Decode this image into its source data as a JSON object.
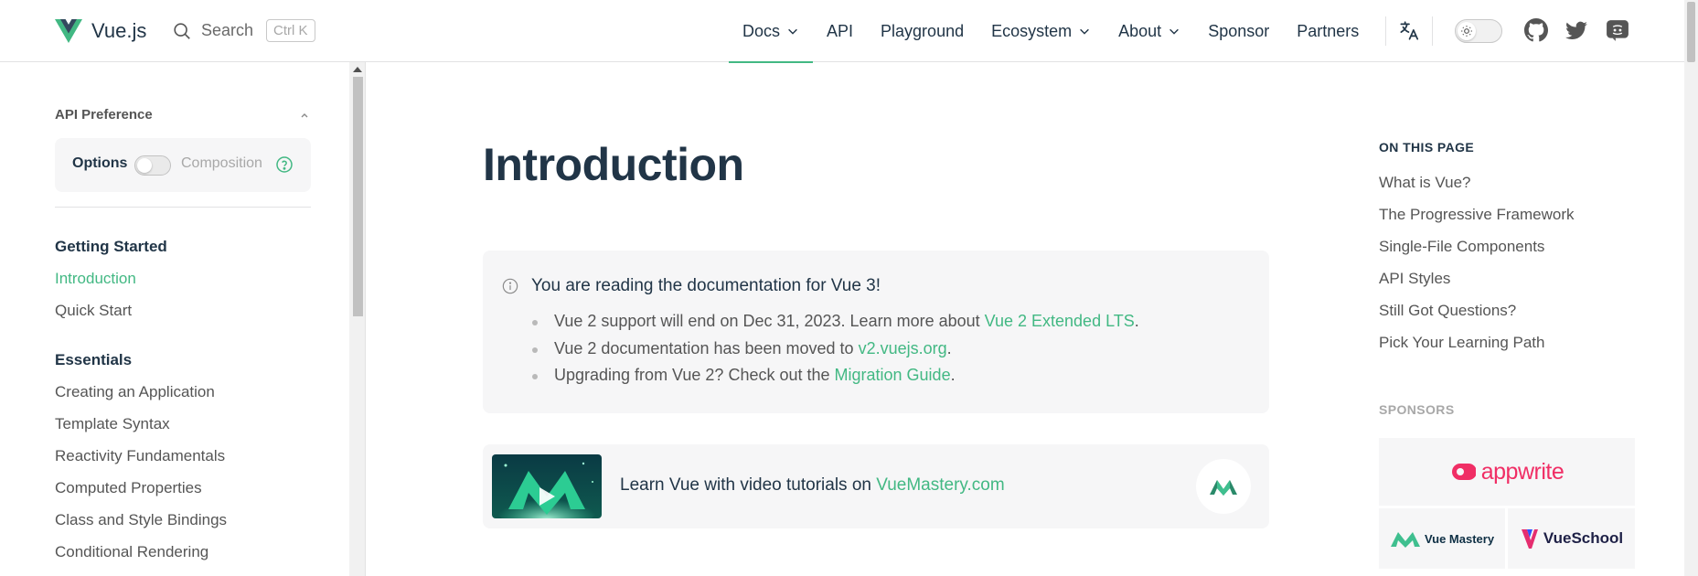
{
  "header": {
    "logo_text": "Vue.js",
    "search_label": "Search",
    "search_shortcut": "Ctrl K",
    "nav": [
      {
        "label": "Docs",
        "dropdown": true,
        "active": true
      },
      {
        "label": "API",
        "dropdown": false
      },
      {
        "label": "Playground",
        "dropdown": false
      },
      {
        "label": "Ecosystem",
        "dropdown": true
      },
      {
        "label": "About",
        "dropdown": true
      },
      {
        "label": "Sponsor",
        "dropdown": false
      },
      {
        "label": "Partners",
        "dropdown": false
      }
    ],
    "icons": [
      "translate-icon",
      "theme-toggle",
      "github-icon",
      "twitter-icon",
      "discord-icon"
    ],
    "accent_color": "#42b883"
  },
  "sidebar": {
    "api_preference_label": "API Preference",
    "options_label": "Options",
    "composition_label": "Composition",
    "groups": [
      {
        "title": "Getting Started",
        "items": [
          "Introduction",
          "Quick Start"
        ]
      },
      {
        "title": "Essentials",
        "items": [
          "Creating an Application",
          "Template Syntax",
          "Reactivity Fundamentals",
          "Computed Properties",
          "Class and Style Bindings",
          "Conditional Rendering"
        ]
      }
    ],
    "active_item": "Introduction"
  },
  "main": {
    "title": "Introduction",
    "info": {
      "title": "You are reading the documentation for Vue 3!",
      "items": [
        {
          "text": "Vue 2 support will end on Dec 31, 2023. Learn more about ",
          "link": "Vue 2 Extended LTS",
          "tail": "."
        },
        {
          "text": "Vue 2 documentation has been moved to ",
          "link": "v2.vuejs.org",
          "tail": "."
        },
        {
          "text": "Upgrading from Vue 2? Check out the ",
          "link": "Migration Guide",
          "tail": "."
        }
      ]
    },
    "banner": {
      "text": "Learn Vue with video tutorials on ",
      "link": "VueMastery.com"
    }
  },
  "aside": {
    "on_this_page_title": "ON THIS PAGE",
    "links": [
      "What is Vue?",
      "The Progressive Framework",
      "Single-File Components",
      "API Styles",
      "Still Got Questions?",
      "Pick Your Learning Path"
    ],
    "sponsors_title": "SPONSORS",
    "sponsors": {
      "appwrite": "appwrite",
      "vue_mastery": "Vue Mastery",
      "vue_school": "VueSchool"
    }
  }
}
